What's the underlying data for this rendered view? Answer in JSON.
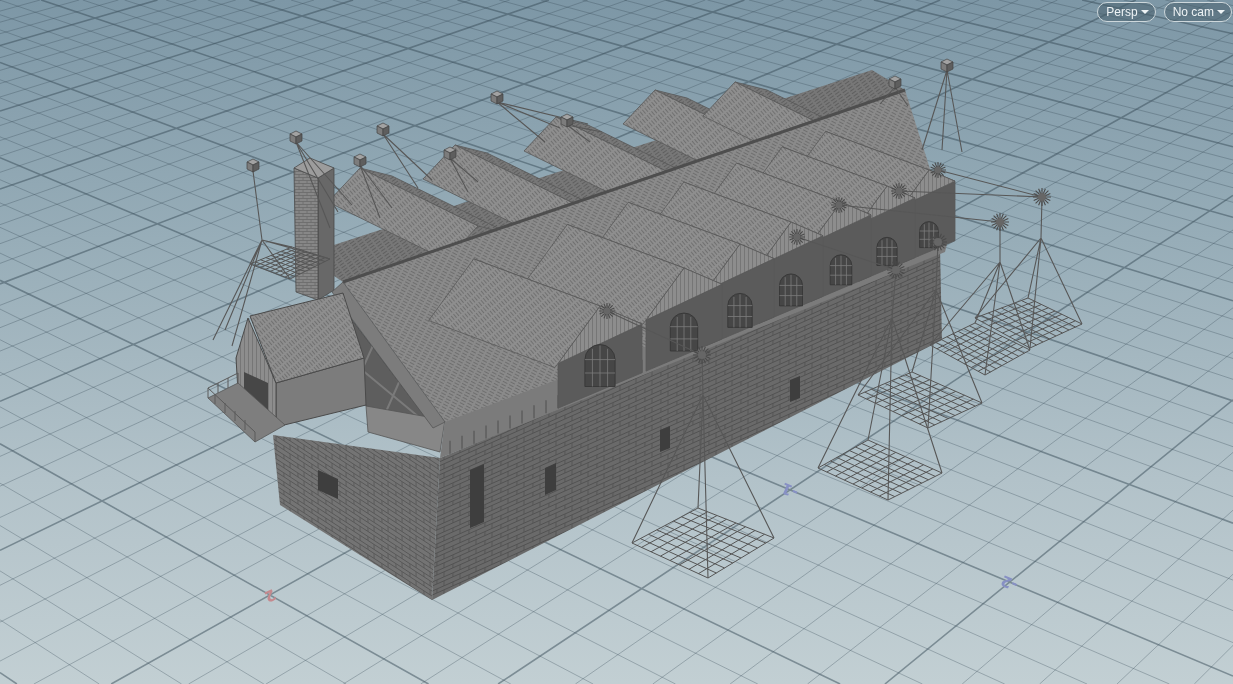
{
  "viewport": {
    "menus": [
      {
        "label": "Persp"
      },
      {
        "label": "No cam"
      }
    ],
    "grid_labels": [
      {
        "text": "2",
        "color": "#c4898e"
      },
      {
        "text": "-1",
        "color": "#8790c4"
      },
      {
        "text": "-2",
        "color": "#8790c4"
      }
    ]
  }
}
